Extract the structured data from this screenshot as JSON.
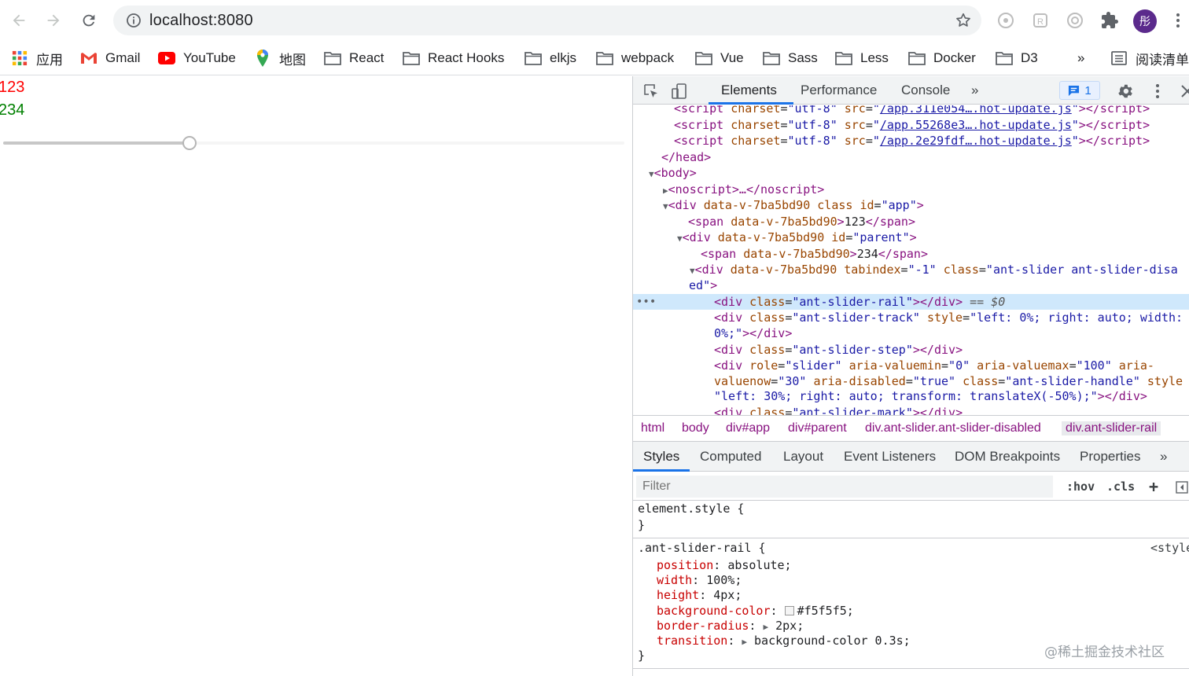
{
  "browser": {
    "url": "localhost:8080",
    "avatar_text": "彤"
  },
  "bookmarks": [
    {
      "label": "应用",
      "icon": "apps-grid-icon"
    },
    {
      "label": "Gmail",
      "icon": "gmail-icon"
    },
    {
      "label": "YouTube",
      "icon": "youtube-icon"
    },
    {
      "label": "地图",
      "icon": "maps-pin-icon"
    },
    {
      "label": "React",
      "icon": "folder-icon"
    },
    {
      "label": "React Hooks",
      "icon": "folder-icon"
    },
    {
      "label": "elkjs",
      "icon": "folder-icon"
    },
    {
      "label": "webpack",
      "icon": "folder-icon"
    },
    {
      "label": "Vue",
      "icon": "folder-icon"
    },
    {
      "label": "Sass",
      "icon": "folder-icon"
    },
    {
      "label": "Less",
      "icon": "folder-icon"
    },
    {
      "label": "Docker",
      "icon": "folder-icon"
    },
    {
      "label": "D3",
      "icon": "folder-icon"
    }
  ],
  "bookmarks_more": "»",
  "reading_list": "阅读清单",
  "page": {
    "span1": "123",
    "span2": "234",
    "slider_value_percent": 30
  },
  "devtools": {
    "tabs": [
      "Elements",
      "Performance",
      "Console"
    ],
    "more_tabs": "»",
    "issues_count": "1",
    "dom": {
      "l1_src": "/app.311e054….hot-update.js",
      "l2_src": "/app.55268e3….hot-update.js",
      "l3_src": "/app.2e29fdf….hot-update.js",
      "script": "script",
      "charset_attr": "charset",
      "charset_val": "utf-8",
      "src_attr": "src",
      "head_close": "</head>",
      "body_open": "<body>",
      "noscript": "<noscript>…</noscript>",
      "app_div_tag": "div",
      "data_attr": "data-v-7ba5bd90",
      "class_attr": "class",
      "id_attr": "id",
      "app_id": "app",
      "span_text_123": "123",
      "parent_id": "parent",
      "span_text_234": "234",
      "tabindex_attr": "tabindex",
      "tabindex_val": "-1",
      "slider_class_a": "ant-slider ant-slider-disa",
      "slider_class_b": "ed",
      "rail_class": "ant-slider-rail",
      "selected_marker": "== $0",
      "track_class": "ant-slider-track",
      "style_attr": "style",
      "track_style_a": "left: 0%; right: auto; width:",
      "track_style_b": "0%;",
      "step_class": "ant-slider-step",
      "role_attr": "role",
      "role_val": "slider",
      "aria_min_attr": "aria-valuemin",
      "aria_min_val": "0",
      "aria_max_attr": "aria-valuemax",
      "aria_max_val": "100",
      "aria_now_attr_a": "aria-",
      "aria_now_attr_b": "valuenow",
      "aria_now_val": "30",
      "aria_dis_attr": "aria-disabled",
      "aria_dis_val": "true",
      "handle_class": "ant-slider-handle",
      "style_attr_short": "style",
      "handle_style": "left: 30%; right: auto; transform: translateX(-50%);",
      "mark_class": "ant-slider-mark"
    },
    "breadcrumbs": [
      "html",
      "body",
      "div#app",
      "div#parent",
      "div.ant-slider.ant-slider-disabled",
      "div.ant-slider-rail"
    ],
    "style_tabs": [
      "Styles",
      "Computed",
      "Layout",
      "Event Listeners",
      "DOM Breakpoints",
      "Properties"
    ],
    "style_more": "»",
    "filter_placeholder": "Filter",
    "hov": ":hov",
    "cls": ".cls",
    "add": "+",
    "element_style_open": "element.style {",
    "close_brace": "}",
    "rail_rule_selector": ".ant-slider-rail {",
    "rail_rule_source": "<style",
    "rail_props": [
      {
        "name": "position",
        "value": "absolute;"
      },
      {
        "name": "width",
        "value": "100%;"
      },
      {
        "name": "height",
        "value": "4px;"
      },
      {
        "name": "background-color",
        "value": "#f5f5f5;"
      },
      {
        "name": "border-radius",
        "value": "2px;"
      },
      {
        "name": "transition",
        "value": "background-color 0.3s;"
      }
    ],
    "watermark": "@稀土掘金技术社区"
  }
}
